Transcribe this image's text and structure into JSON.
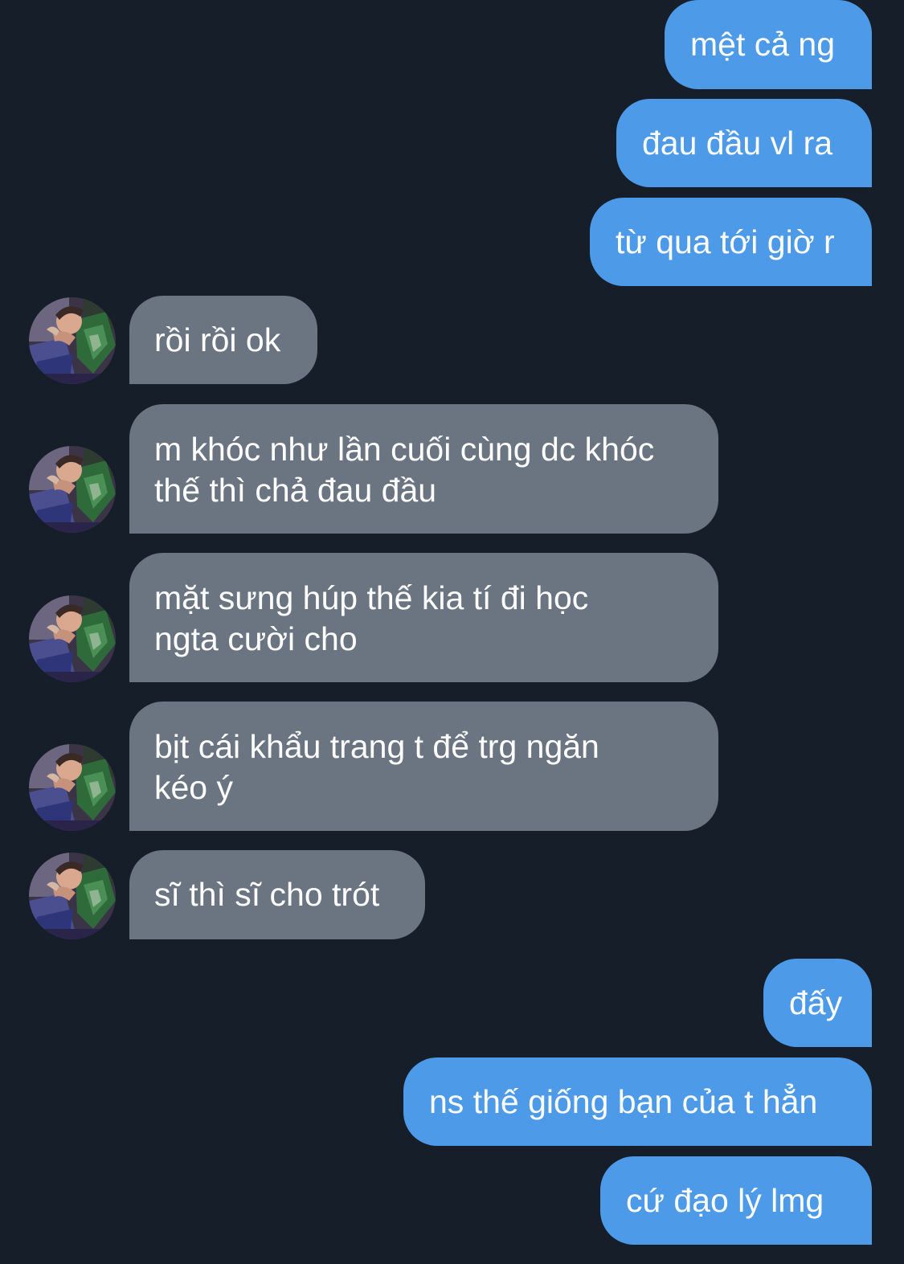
{
  "messages": [
    {
      "direction": "outgoing",
      "text": "mệt cả ng"
    },
    {
      "direction": "outgoing",
      "text": "đau đầu vl ra"
    },
    {
      "direction": "outgoing",
      "text": "từ qua tới giờ r"
    },
    {
      "direction": "incoming",
      "text": "rồi rồi ok"
    },
    {
      "direction": "incoming",
      "lines": [
        "m khóc như lần cuối cùng dc khóc",
        "thế thì chả đau đầu"
      ]
    },
    {
      "direction": "incoming",
      "lines": [
        "mặt sưng húp thế kia tí đi học",
        "ngta cười cho"
      ]
    },
    {
      "direction": "incoming",
      "lines": [
        "bịt cái khẩu trang t để trg ngăn",
        "kéo ý"
      ]
    },
    {
      "direction": "incoming",
      "text": "sĩ thì sĩ cho trót"
    },
    {
      "direction": "outgoing",
      "text": "đấy"
    },
    {
      "direction": "outgoing",
      "text": "ns thế giống bạn của t hẳn"
    },
    {
      "direction": "outgoing",
      "text": "cứ đạo lý lmg"
    }
  ],
  "colors": {
    "background": "#161e29",
    "outgoing_bubble": "#4c9ae8",
    "incoming_bubble": "#6a7581",
    "text": "#ffffff"
  },
  "icons": {
    "avatar": "contact-avatar-photo"
  }
}
